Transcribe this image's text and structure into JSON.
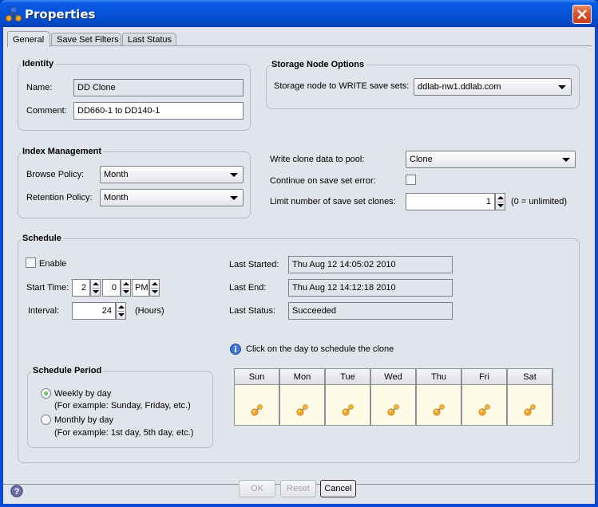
{
  "window": {
    "title": "Properties",
    "icon": "network-nodes-icon",
    "close_icon": "close-icon"
  },
  "tabs": [
    {
      "label": "General",
      "active": true
    },
    {
      "label": "Save Set Filters",
      "active": false
    },
    {
      "label": "Last Status",
      "active": false
    }
  ],
  "identity": {
    "title": "Identity",
    "name_label": "Name:",
    "name_value": "DD Clone",
    "comment_label": "Comment:",
    "comment_value": "DD660-1 to DD140-1"
  },
  "storage_node": {
    "title": "Storage Node Options",
    "write_label": "Storage node to WRITE save sets:",
    "write_value": "ddlab-nw1.ddlab.com"
  },
  "index_management": {
    "title": "Index Management",
    "browse_label": "Browse Policy:",
    "browse_value": "Month",
    "retention_label": "Retention Policy:",
    "retention_value": "Month"
  },
  "clone_options": {
    "pool_label": "Write clone data to pool:",
    "pool_value": "Clone",
    "continue_label": "Continue on save set error:",
    "continue_checked": false,
    "limit_label": "Limit number of save set clones:",
    "limit_value": "1",
    "limit_hint": "(0 = unlimited)"
  },
  "schedule": {
    "title": "Schedule",
    "enable_label": "Enable",
    "enable_checked": false,
    "start_time_label": "Start Time:",
    "start_hour": "2",
    "start_minute": "0",
    "start_ampm": "PM",
    "interval_label": "Interval:",
    "interval_value": "24",
    "interval_unit": "(Hours)",
    "last_started_label": "Last Started:",
    "last_started_value": "Thu Aug 12 14:05:02 2010",
    "last_end_label": "Last End:",
    "last_end_value": "Thu Aug 12 14:12:18 2010",
    "last_status_label": "Last Status:",
    "last_status_value": "Succeeded",
    "info_text": "Click on the day to schedule the clone",
    "days": [
      "Sun",
      "Mon",
      "Tue",
      "Wed",
      "Thu",
      "Fri",
      "Sat"
    ],
    "period": {
      "title": "Schedule Period",
      "options": [
        {
          "label": "Weekly by day",
          "hint": "(For example: Sunday, Friday, etc.)",
          "selected": true
        },
        {
          "label": "Monthly by day",
          "hint": "(For example: 1st day, 5th day, etc.)",
          "selected": false
        }
      ]
    }
  },
  "footer": {
    "ok_label": "OK",
    "reset_label": "Reset",
    "cancel_label": "Cancel"
  }
}
